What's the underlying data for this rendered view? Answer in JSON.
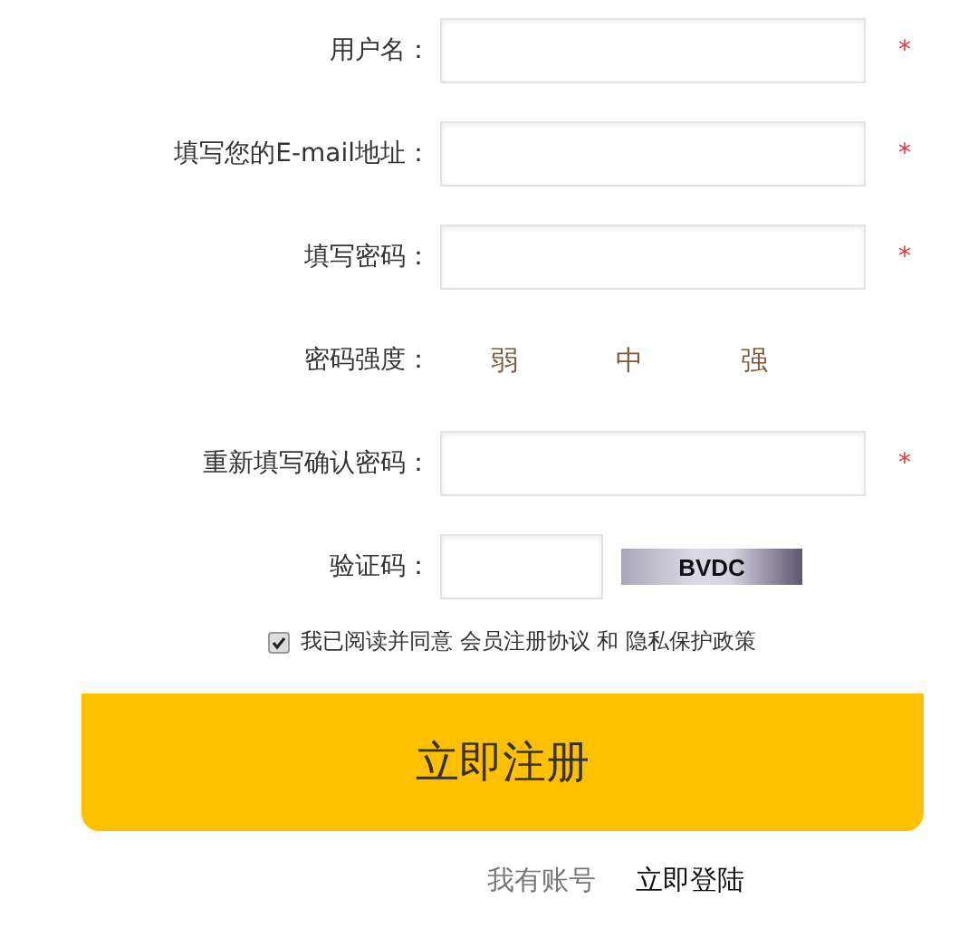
{
  "fields": [
    {
      "kind": "input",
      "label": "用户名：",
      "required_mark": "*"
    },
    {
      "kind": "input",
      "label": "填写您的E-mail地址：",
      "required_mark": "*"
    },
    {
      "kind": "input",
      "label": "填写密码：",
      "required_mark": "*"
    },
    {
      "kind": "strength",
      "label": "密码强度：",
      "levels": [
        "弱",
        "中",
        "强"
      ]
    },
    {
      "kind": "input",
      "label": "重新填写确认密码：",
      "required_mark": "*"
    },
    {
      "kind": "captcha",
      "label": "验证码：",
      "captcha": "BVDC"
    }
  ],
  "agreement": {
    "checked": true,
    "text": "我已阅读并同意 会员注册协议 和 隐私保护政策"
  },
  "submit": "立即注册",
  "footer": {
    "prompt": "我有账号",
    "link": "立即登陆"
  }
}
